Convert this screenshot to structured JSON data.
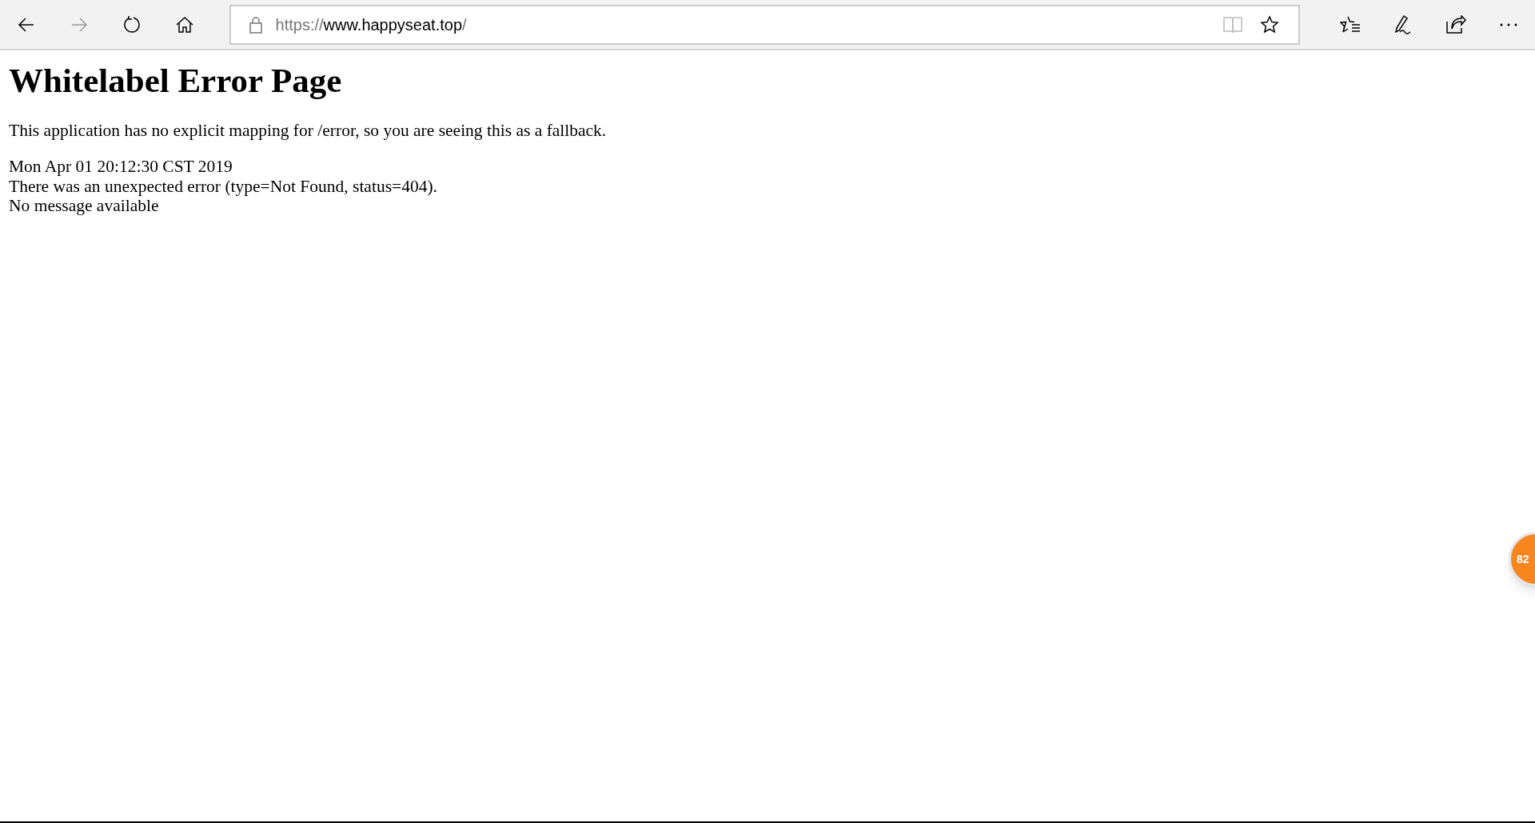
{
  "toolbar": {
    "back": {
      "disabled": false
    },
    "forward": {
      "disabled": true
    },
    "address": {
      "scheme": "https://",
      "host": "www.happyseat.top",
      "path": "/"
    }
  },
  "page": {
    "heading": "Whitelabel Error Page",
    "intro": "This application has no explicit mapping for /error, so you are seeing this as a fallback.",
    "details": [
      "Mon Apr 01 20:12:30 CST 2019",
      "There was an unexpected error (type=Not Found, status=404).",
      "No message available"
    ]
  },
  "floating_badge": {
    "count": "82"
  }
}
